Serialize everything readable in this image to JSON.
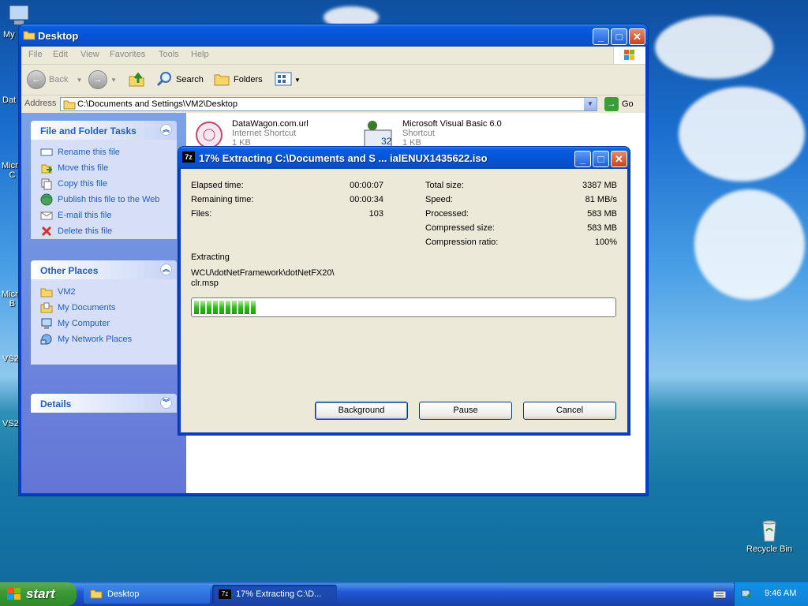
{
  "desktop": {
    "icons": [
      {
        "label": "My"
      },
      {
        "label": "Dat"
      },
      {
        "label": "Micro\nC"
      },
      {
        "label": "Micro\nB"
      },
      {
        "label": "VS2"
      },
      {
        "label": "VS2"
      }
    ],
    "recycle_bin": "Recycle Bin"
  },
  "explorer": {
    "title": "Desktop",
    "menu": [
      "File",
      "Edit",
      "View",
      "Favorites",
      "Tools",
      "Help"
    ],
    "toolbar": {
      "back": "Back",
      "search": "Search",
      "folders": "Folders"
    },
    "address": {
      "label": "Address",
      "value": "C:\\Documents and Settings\\VM2\\Desktop",
      "go": "Go"
    },
    "file_tasks": {
      "title": "File and Folder Tasks",
      "items": [
        "Rename this file",
        "Move this file",
        "Copy this file",
        "Publish this file to the Web",
        "E-mail this file",
        "Delete this file"
      ]
    },
    "other_places": {
      "title": "Other Places",
      "items": [
        "VM2",
        "My Documents",
        "My Computer",
        "My Network Places"
      ]
    },
    "details": {
      "title": "Details"
    },
    "files": [
      {
        "name": "DataWagon.com.url",
        "type": "Internet Shortcut",
        "size": "1 KB"
      },
      {
        "name": "Microsoft Visual Basic 6.0",
        "type": "Shortcut",
        "size": "1 KB"
      }
    ]
  },
  "dialog": {
    "title": "17% Extracting C:\\Documents and S ... ialENUX1435622.iso",
    "left_stats": [
      {
        "label": "Elapsed time:",
        "value": "00:00:07"
      },
      {
        "label": "Remaining time:",
        "value": "00:00:34"
      },
      {
        "label": "Files:",
        "value": "103"
      }
    ],
    "right_stats": [
      {
        "label": "Total size:",
        "value": "3387 MB"
      },
      {
        "label": "Speed:",
        "value": "81 MB/s"
      },
      {
        "label": "Processed:",
        "value": "583 MB"
      },
      {
        "label": "Compressed size:",
        "value": "583 MB"
      },
      {
        "label": "Compression ratio:",
        "value": "100%"
      }
    ],
    "status": "Extracting",
    "current_path": "WCU\\dotNetFramework\\dotNetFX20\\",
    "current_file": "clr.msp",
    "progress": 0.17,
    "buttons": {
      "background": "Background",
      "pause": "Pause",
      "cancel": "Cancel"
    }
  },
  "taskbar": {
    "start": "start",
    "tasks": [
      "Desktop",
      "17% Extracting C:\\D..."
    ],
    "clock": "9:46 AM"
  }
}
